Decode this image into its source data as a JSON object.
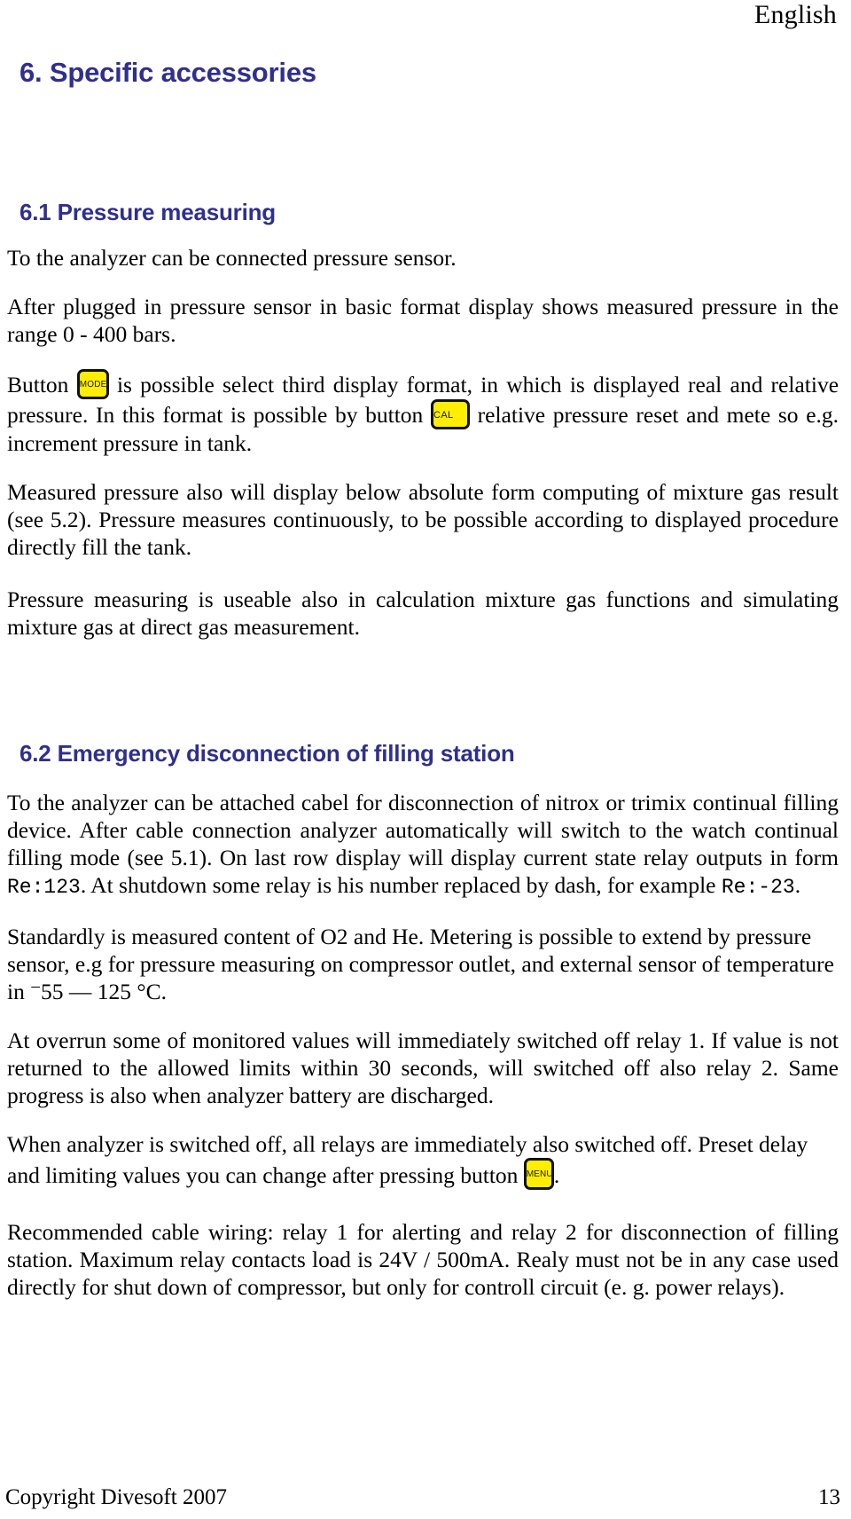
{
  "page": {
    "running_head": "English",
    "language": "English"
  },
  "headings": {
    "section_6": "6. Specific accessories",
    "section_6_1": "6.1 Pressure measuring",
    "section_6_2": "6.2 Emergency disconnection of filling station",
    "color": "#2f2f8f"
  },
  "keys": {
    "mode": "MODE",
    "cal": "CAL",
    "menu": "MENU",
    "fill_color": "#FFEE00",
    "border_color": "#111111"
  },
  "section_6_1": {
    "p1": "To the analyzer can be connected pressure sensor.",
    "p2": "After plugged in pressure sensor in basic format display shows measured pressure in the range 0 - 400 bars.",
    "p3_a": "Button",
    "p3_b": "is possible select third display format, in which is displayed real and relative pressure.  In this format is possible by button",
    "p3_c": "relative pressure reset and mete so e.g. increment pressure in tank.",
    "p4": "Measured pressure also will display below absolute form computing of mixture gas result (see 5.2). Pressure measures continuously, to be possible according to displayed procedure directly fill the tank.",
    "p5": "Pressure measuring is useable also in calculation mixture gas functions and simulating mixture gas at direct gas measurement."
  },
  "section_6_2": {
    "p1_a": "To the analyzer can be attached cabel for disconnection of nitrox or trimix continual filling device. After cable connection analyzer automatically will switch to the watch continual filling mode (see 5.1). On last row display will display current state relay outputs in form",
    "p1_mono1": "Re:123",
    "p1_b": ". At shutdown some relay is his number replaced by dash, for example",
    "p1_mono2": "Re:-23",
    "p1_c": ".",
    "p2_a": "Standardly is measured content of O2 and He.  Metering is possible to extend by pressure sensor, e.g for pressure measuring on compressor outlet, and external sensor of temperature in",
    "p2_minus": "−",
    "p2_range": "55 — 125 °C.",
    "p3": "At overrun some of monitored values will immediately switched off relay 1.  If value is not returned to the allowed limits within 30 seconds, will switched off also relay 2. Same progress is also when analyzer battery are discharged.",
    "p4_a": "When analyzer is switched off, all relays are immediately also switched off. Preset delay and limiting values you can change after pressing button",
    "p4_b": ".",
    "p5": "Recommended cable wiring: relay 1 for alerting and relay 2 for disconnection of filling station. Maximum relay contacts load is 24V / 500mA. Realy must not be in any case used directly for shut down of compressor, but only for controll circuit (e. g. power relays)."
  },
  "footer": {
    "copyright": "Copyright Divesoft 2007",
    "page_number": "13"
  }
}
